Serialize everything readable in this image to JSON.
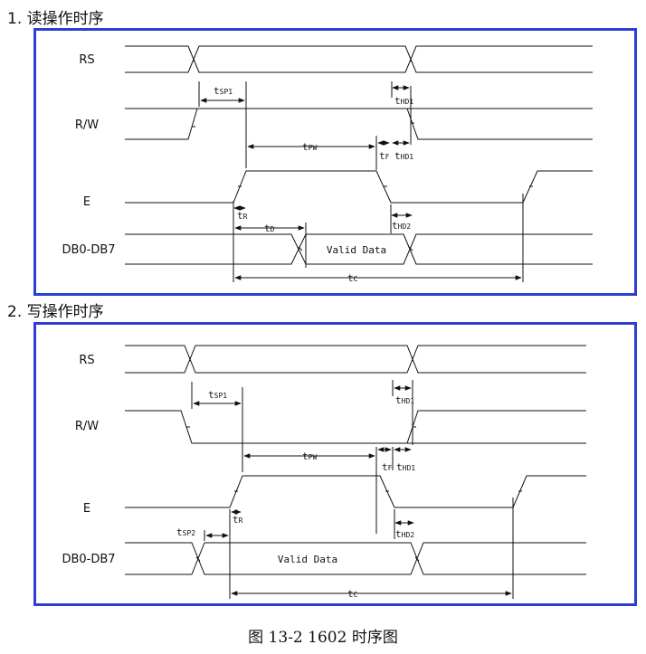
{
  "section1": {
    "heading": "1. 读操作时序",
    "signals": {
      "rs": "RS",
      "rw": "R/W",
      "e": "E",
      "db": "DB0-DB7"
    },
    "data_label": "Valid Data",
    "timing": {
      "tsp1": {
        "main": "t",
        "sub": "SP1"
      },
      "tpw": {
        "main": "t",
        "sub": "PW"
      },
      "tf": {
        "main": "t",
        "sub": "F"
      },
      "thd1_rs": {
        "main": "t",
        "sub": "HD1"
      },
      "thd1_rw": {
        "main": "t",
        "sub": "HD1"
      },
      "tr": {
        "main": "t",
        "sub": "R"
      },
      "td": {
        "main": "t",
        "sub": "D"
      },
      "thd2": {
        "main": "t",
        "sub": "HD2"
      },
      "tc": {
        "main": "t",
        "sub": "C"
      }
    }
  },
  "section2": {
    "heading": "2. 写操作时序",
    "signals": {
      "rs": "RS",
      "rw": "R/W",
      "e": "E",
      "db": "DB0-DB7"
    },
    "data_label": "Valid Data",
    "timing": {
      "tsp1": {
        "main": "t",
        "sub": "SP1"
      },
      "tpw": {
        "main": "t",
        "sub": "PW"
      },
      "tf": {
        "main": "t",
        "sub": "F"
      },
      "thd1_rs": {
        "main": "t",
        "sub": "HD1"
      },
      "thd1_rw": {
        "main": "t",
        "sub": "HD1"
      },
      "tr": {
        "main": "t",
        "sub": "R"
      },
      "tsp2": {
        "main": "t",
        "sub": "SP2"
      },
      "thd2": {
        "main": "t",
        "sub": "HD2"
      },
      "tc": {
        "main": "t",
        "sub": "C"
      }
    }
  },
  "caption": "图 13-2    1602 时序图"
}
